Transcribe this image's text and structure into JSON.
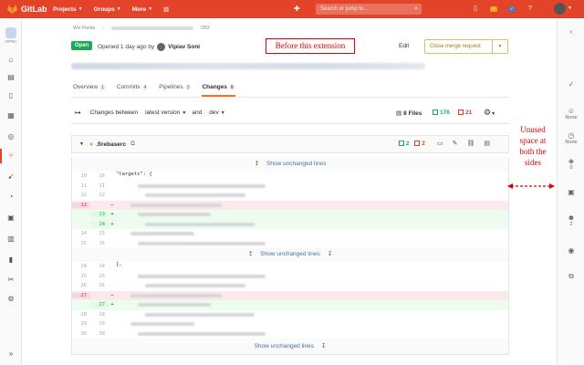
{
  "topbar": {
    "brand": "GitLab",
    "nav": [
      {
        "label": "Projects"
      },
      {
        "label": "Groups"
      },
      {
        "label": "More"
      }
    ],
    "search_placeholder": "Search or jump to…",
    "issues_badge": "",
    "mr_badge": "",
    "todo_badge": ""
  },
  "sidebar": {
    "project_abbrev": "OPRC"
  },
  "breadcrumb": {
    "group": "Wiz Panda",
    "id": "!283"
  },
  "mr": {
    "status": "Open",
    "opened_text": "Opened 1 day ago by",
    "author": "Vipiav Soni",
    "edit_label": "Edit",
    "close_label": "Close merge request"
  },
  "tabs": [
    {
      "label": "Overview",
      "count": "1"
    },
    {
      "label": "Commits",
      "count": "4"
    },
    {
      "label": "Pipelines",
      "count": "3"
    },
    {
      "label": "Changes",
      "count": "8"
    }
  ],
  "diff_controls": {
    "changes_between": "Changes between",
    "from_version": "latest version",
    "and": "and",
    "to_version": "dev",
    "files": "8 Files",
    "additions": "176",
    "deletions": "21"
  },
  "file": {
    "name": ".firebaserc",
    "additions": "2",
    "deletions": "2"
  },
  "show_unchanged": "Show unchanged lines",
  "hunk1": [
    {
      "o": "10",
      "n": "10",
      "t": "ctx",
      "code": "  \"targets\": {"
    },
    {
      "o": "11",
      "n": "11",
      "t": "ctx",
      "code": ""
    },
    {
      "o": "12",
      "n": "12",
      "t": "ctx",
      "code": ""
    },
    {
      "o": "13",
      "n": "",
      "t": "del",
      "code": ""
    },
    {
      "o": "",
      "n": "13",
      "t": "add",
      "code": ""
    },
    {
      "o": "",
      "n": "14",
      "t": "add",
      "code": ""
    },
    {
      "o": "14",
      "n": "15",
      "t": "ctx",
      "code": ""
    },
    {
      "o": "15",
      "n": "16",
      "t": "ctx",
      "code": ""
    },
    {
      "o": "16",
      "n": "16",
      "t": "ctx",
      "code": ""
    }
  ],
  "hunk2": [
    {
      "o": "24",
      "n": "24",
      "t": "ctx",
      "code": "    },"
    },
    {
      "o": "25",
      "n": "25",
      "t": "ctx",
      "code": ""
    },
    {
      "o": "26",
      "n": "26",
      "t": "ctx",
      "code": ""
    },
    {
      "o": "27",
      "n": "",
      "t": "del",
      "code": ""
    },
    {
      "o": "",
      "n": "27",
      "t": "add",
      "code": ""
    },
    {
      "o": "28",
      "n": "28",
      "t": "ctx",
      "code": ""
    },
    {
      "o": "29",
      "n": "29",
      "t": "ctx",
      "code": ""
    },
    {
      "o": "30",
      "n": "30",
      "t": "ctx",
      "code": ""
    }
  ],
  "rightbar": {
    "assignee": "None",
    "milestone": "None",
    "labels": "0",
    "participants": "2"
  },
  "annotations": {
    "before": "Before this extension",
    "unused": "Unused space at both the sides"
  },
  "colors": {
    "brand": "#e24329",
    "open": "#1aaa55",
    "deletion": "#db3b21",
    "annotation": "#dd0000"
  }
}
